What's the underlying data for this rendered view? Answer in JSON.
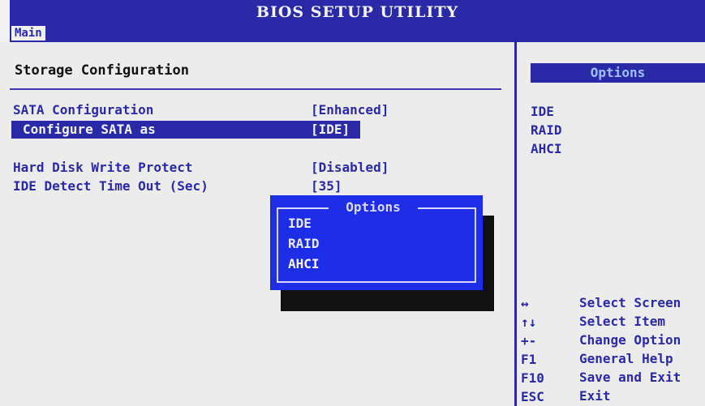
{
  "title": "BIOS SETUP UTILITY",
  "menu": {
    "active_tab": "Main"
  },
  "section_title": "Storage Configuration",
  "settings": [
    {
      "label": "SATA Configuration",
      "value": "[Enhanced]"
    },
    {
      "label": "Configure SATA as",
      "value": "[IDE]",
      "selected": true
    },
    {
      "label": "Hard Disk Write Protect",
      "value": "[Disabled]"
    },
    {
      "label": "IDE Detect Time Out (Sec)",
      "value": "[35]"
    }
  ],
  "right_panel": {
    "header": "Options",
    "options": [
      "IDE",
      "RAID",
      "AHCI"
    ]
  },
  "popup": {
    "title": "Options",
    "items": [
      "IDE",
      "RAID",
      "AHCI"
    ],
    "highlighted": "AHCI"
  },
  "help": [
    {
      "key": "↔",
      "action": "Select Screen"
    },
    {
      "key": "↑↓",
      "action": "Select Item"
    },
    {
      "key": "+-",
      "action": "Change Option"
    },
    {
      "key": "F1",
      "action": "General Help"
    },
    {
      "key": "F10",
      "action": "Save and Exit"
    },
    {
      "key": "ESC",
      "action": "Exit"
    }
  ],
  "colors": {
    "bios_blue": "#2a2aa8",
    "popup_blue": "#1e2ee8",
    "background": "#ececec",
    "header_text": "#9ec0ff"
  }
}
